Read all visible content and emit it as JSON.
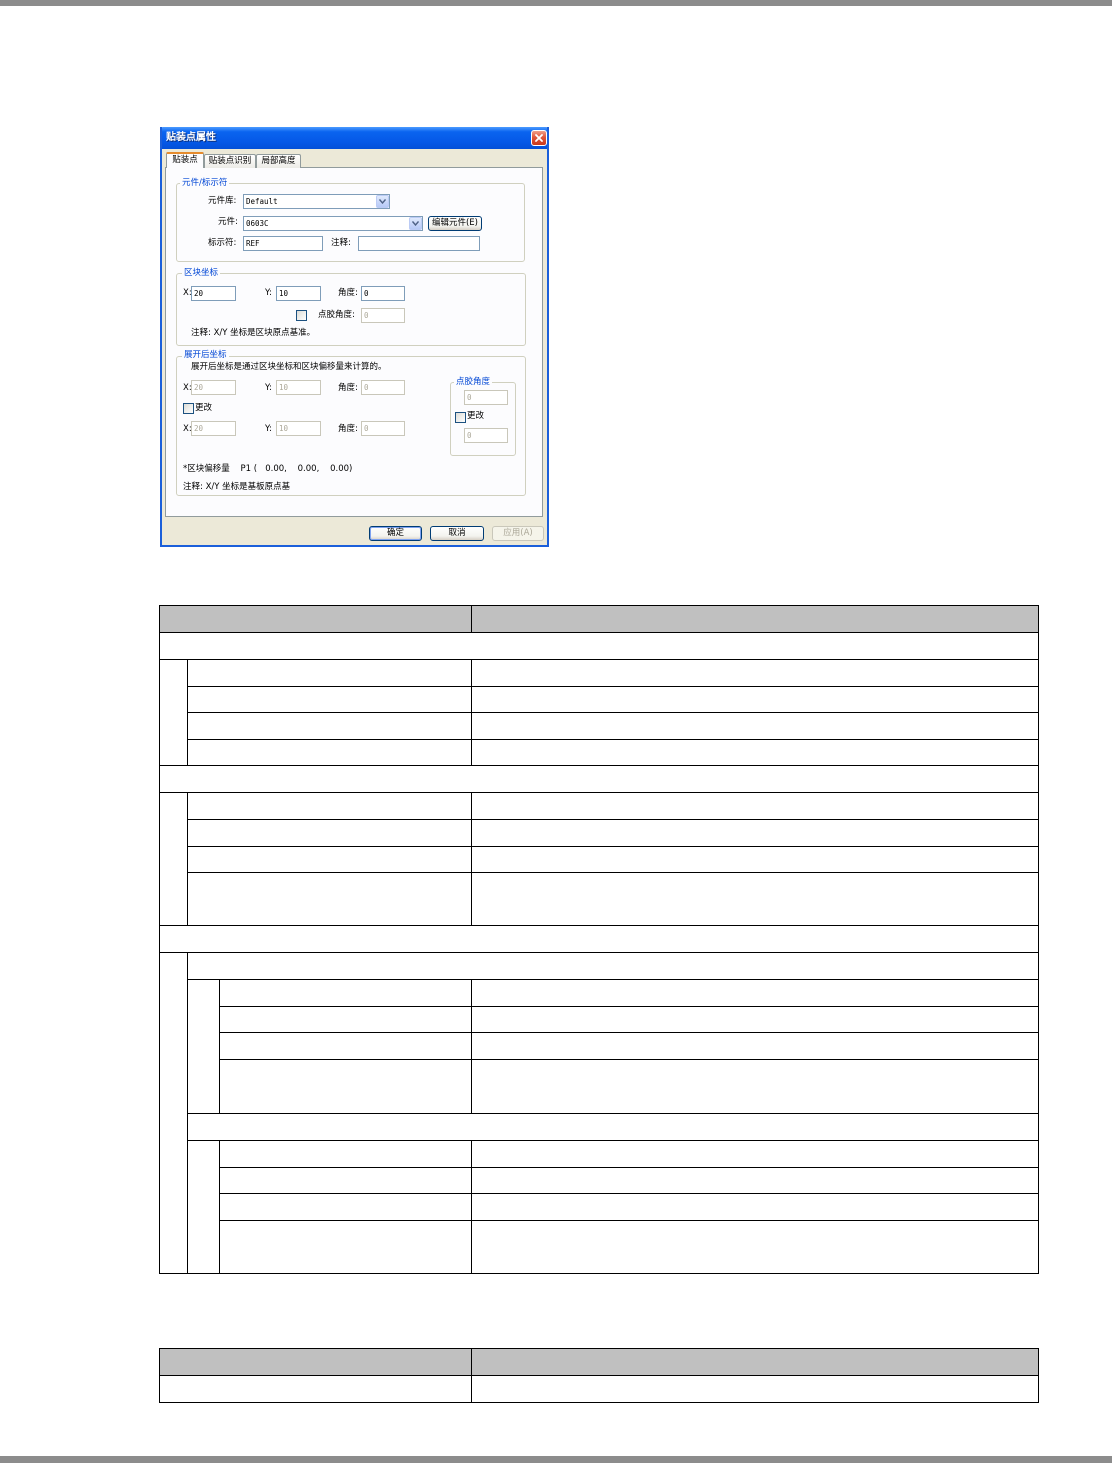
{
  "dialog": {
    "title": "贴装点属性",
    "tabs": [
      "贴装点",
      "贴装点识别",
      "局部高度"
    ],
    "group_component": {
      "title": "元件/标示符",
      "library_label": "元件库:",
      "library_value": "Default",
      "component_label": "元件:",
      "component_value": "0603C",
      "edit_button": "编辑元件(E)",
      "ref_label": "标示符:",
      "ref_value": "REF",
      "comment_label": "注释:"
    },
    "group_block": {
      "title": "区块坐标",
      "x_label": "X:",
      "x_value": "20",
      "y_label": "Y:",
      "y_value": "10",
      "angle_label": "角度:",
      "angle_value": "0",
      "dispense_label": "点胶角度:",
      "dispense_value": "0",
      "note": "注释: X/Y 坐标是区块原点基准。"
    },
    "group_expanded": {
      "title": "展开后坐标",
      "description": "展开后坐标是通过区块坐标和区块偏移量来计算的。",
      "row1": {
        "x": "20",
        "y": "10",
        "angle": "0"
      },
      "change_label": "更改",
      "row2": {
        "x": "20",
        "y": "10",
        "angle": "0"
      },
      "dispense": {
        "title": "点胶角度",
        "value1": "0",
        "change_label": "更改",
        "value2": "0"
      },
      "offset": "*区块偏移量    P1 (   0.00,    0.00,    0.00)",
      "note": "注释: X/Y 坐标是基板原点基"
    },
    "buttons": {
      "ok": "确定",
      "cancel": "取消",
      "apply": "应用(A)"
    }
  },
  "colors": {
    "titlebar": "#0558E6",
    "dialog_bg": "#ECE9D8",
    "group_title": "#0046D5",
    "table_header": "#C0C0C0"
  }
}
